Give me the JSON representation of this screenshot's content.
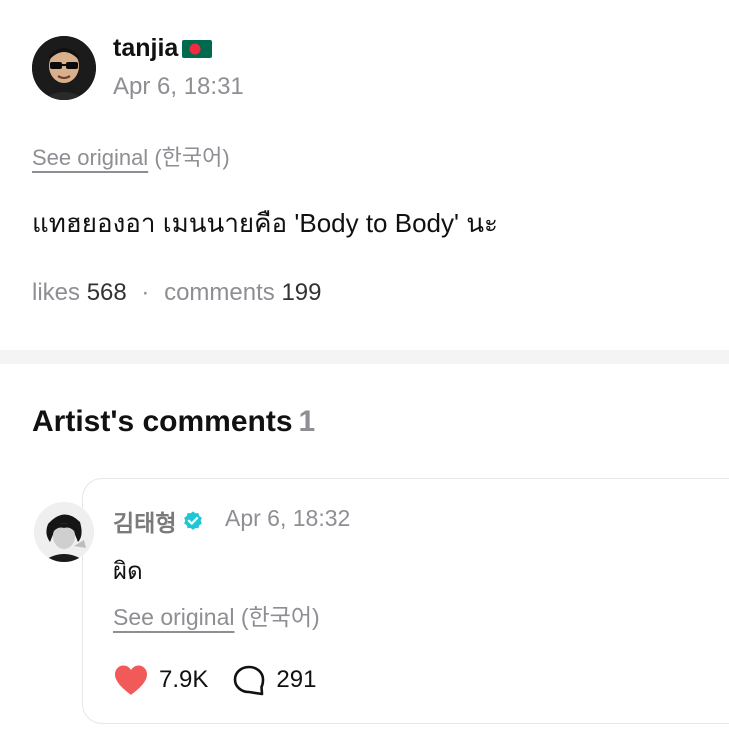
{
  "post": {
    "username": "tanjia",
    "flag_icon": "bangladesh-flag-icon",
    "time": "Apr 6, 18:31",
    "see_original_link": "See original",
    "see_original_lang": "(한국어)",
    "body": "แทฮยองอา เมนนายคือ 'Body to Body' นะ",
    "likes_label": "likes",
    "likes_count": "568",
    "separator": "·",
    "comments_label": "comments",
    "comments_count": "199"
  },
  "artist_comments": {
    "title": "Artist's comments",
    "count": "1",
    "items": [
      {
        "name": "김태형",
        "verified_icon": "verified-badge-icon",
        "time": "Apr 6, 18:32",
        "body": "ผิด",
        "see_original_link": "See original",
        "see_original_lang": "(한국어)",
        "like_count": "7.9K",
        "reply_count": "291"
      }
    ]
  },
  "colors": {
    "like_heart": "#f25a5a",
    "verified": "#1fc7d4",
    "muted_text": "#8e8e93",
    "divider": "#f4f4f4"
  }
}
